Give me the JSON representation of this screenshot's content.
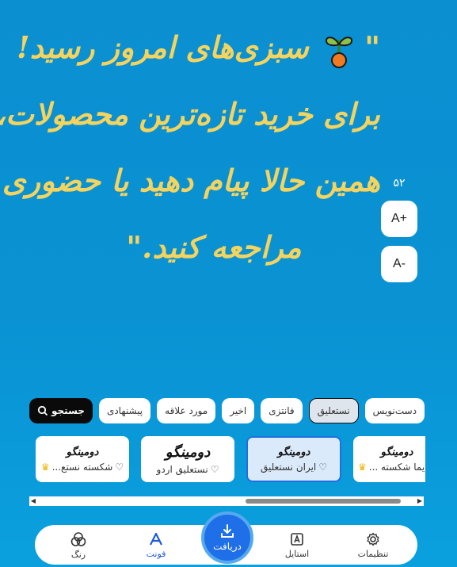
{
  "preview": {
    "lines": [
      "سبزی‌های امروز رسید!",
      "برای خرید تازه‌ترین محصولات،",
      "همین حالا پیام دهید یا حضوری",
      "مراجعه کنید.\""
    ],
    "open_quote": "\"",
    "text_color": "#f4d35e"
  },
  "font_size": {
    "value": "۵۲",
    "increase_label": "A+",
    "decrease_label": "A-"
  },
  "filters": {
    "search_label": "جستجو",
    "chips": [
      "پیشنهادی",
      "مورد علاقه",
      "اخیر",
      "فانتزی",
      "نستعلیق",
      "دست‌نویس"
    ],
    "active": "نستعلیق"
  },
  "fonts": {
    "sample_text": "دومینگو",
    "cards": [
      {
        "name": "یما شکسته ...",
        "premium": true
      },
      {
        "name": "ایران نستعلیق",
        "premium": false,
        "selected": true
      },
      {
        "name": "نستعلیق اردو",
        "premium": false
      },
      {
        "name": "شکسته نستع...",
        "premium": true
      }
    ]
  },
  "bottom_nav": {
    "settings": "تنظیمات",
    "style": "استایل",
    "download": "دریافت",
    "font": "فونت",
    "color": "رنگ",
    "active": "font"
  },
  "colors": {
    "background": "#0b8fd1",
    "accent": "#1e6fe8",
    "premium": "#f0b400"
  }
}
